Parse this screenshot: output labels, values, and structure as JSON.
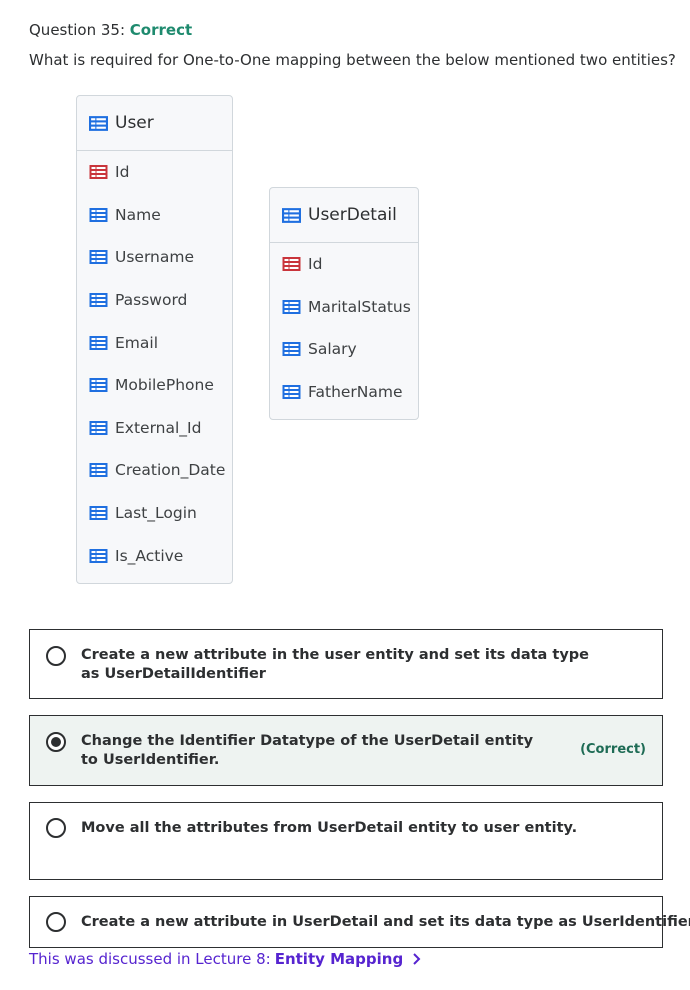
{
  "question": {
    "prefix": "Question 35:",
    "status": "Correct",
    "text": "What is required for One-to-One mapping between the below mentioned two entities?"
  },
  "entities": {
    "user": {
      "title": "User",
      "attributes": [
        "Id",
        "Name",
        "Username",
        "Password",
        "Email",
        "MobilePhone",
        "External_Id",
        "Creation_Date",
        "Last_Login",
        "Is_Active"
      ]
    },
    "userdetail": {
      "title": "UserDetail",
      "attributes": [
        "Id",
        "MaritalStatus",
        "Salary",
        "FatherName"
      ]
    }
  },
  "icons": {
    "entity": "table-icon-blue",
    "identifier": "table-icon-red",
    "attribute": "table-icon-blue",
    "colors": {
      "blue": "#1f6fe0",
      "red": "#c9343b",
      "accent": "#1e8a6e",
      "link": "#5624d0"
    }
  },
  "options": [
    {
      "text": "Create a new attribute in the user entity and set its data type as UserDetailIdentifier",
      "selected": false,
      "badge": ""
    },
    {
      "text": "Change the Identifier Datatype of the UserDetail entity to UserIdentifier.",
      "selected": true,
      "badge": "(Correct)"
    },
    {
      "text": "Move all the attributes from UserDetail entity to user entity.",
      "selected": false,
      "badge": ""
    },
    {
      "text": "Create a new attribute in UserDetail and set its data type as UserIdentifier",
      "selected": false,
      "badge": ""
    }
  ],
  "lecture": {
    "prefix": "This was discussed in Lecture 8:",
    "ref": "Entity Mapping"
  }
}
